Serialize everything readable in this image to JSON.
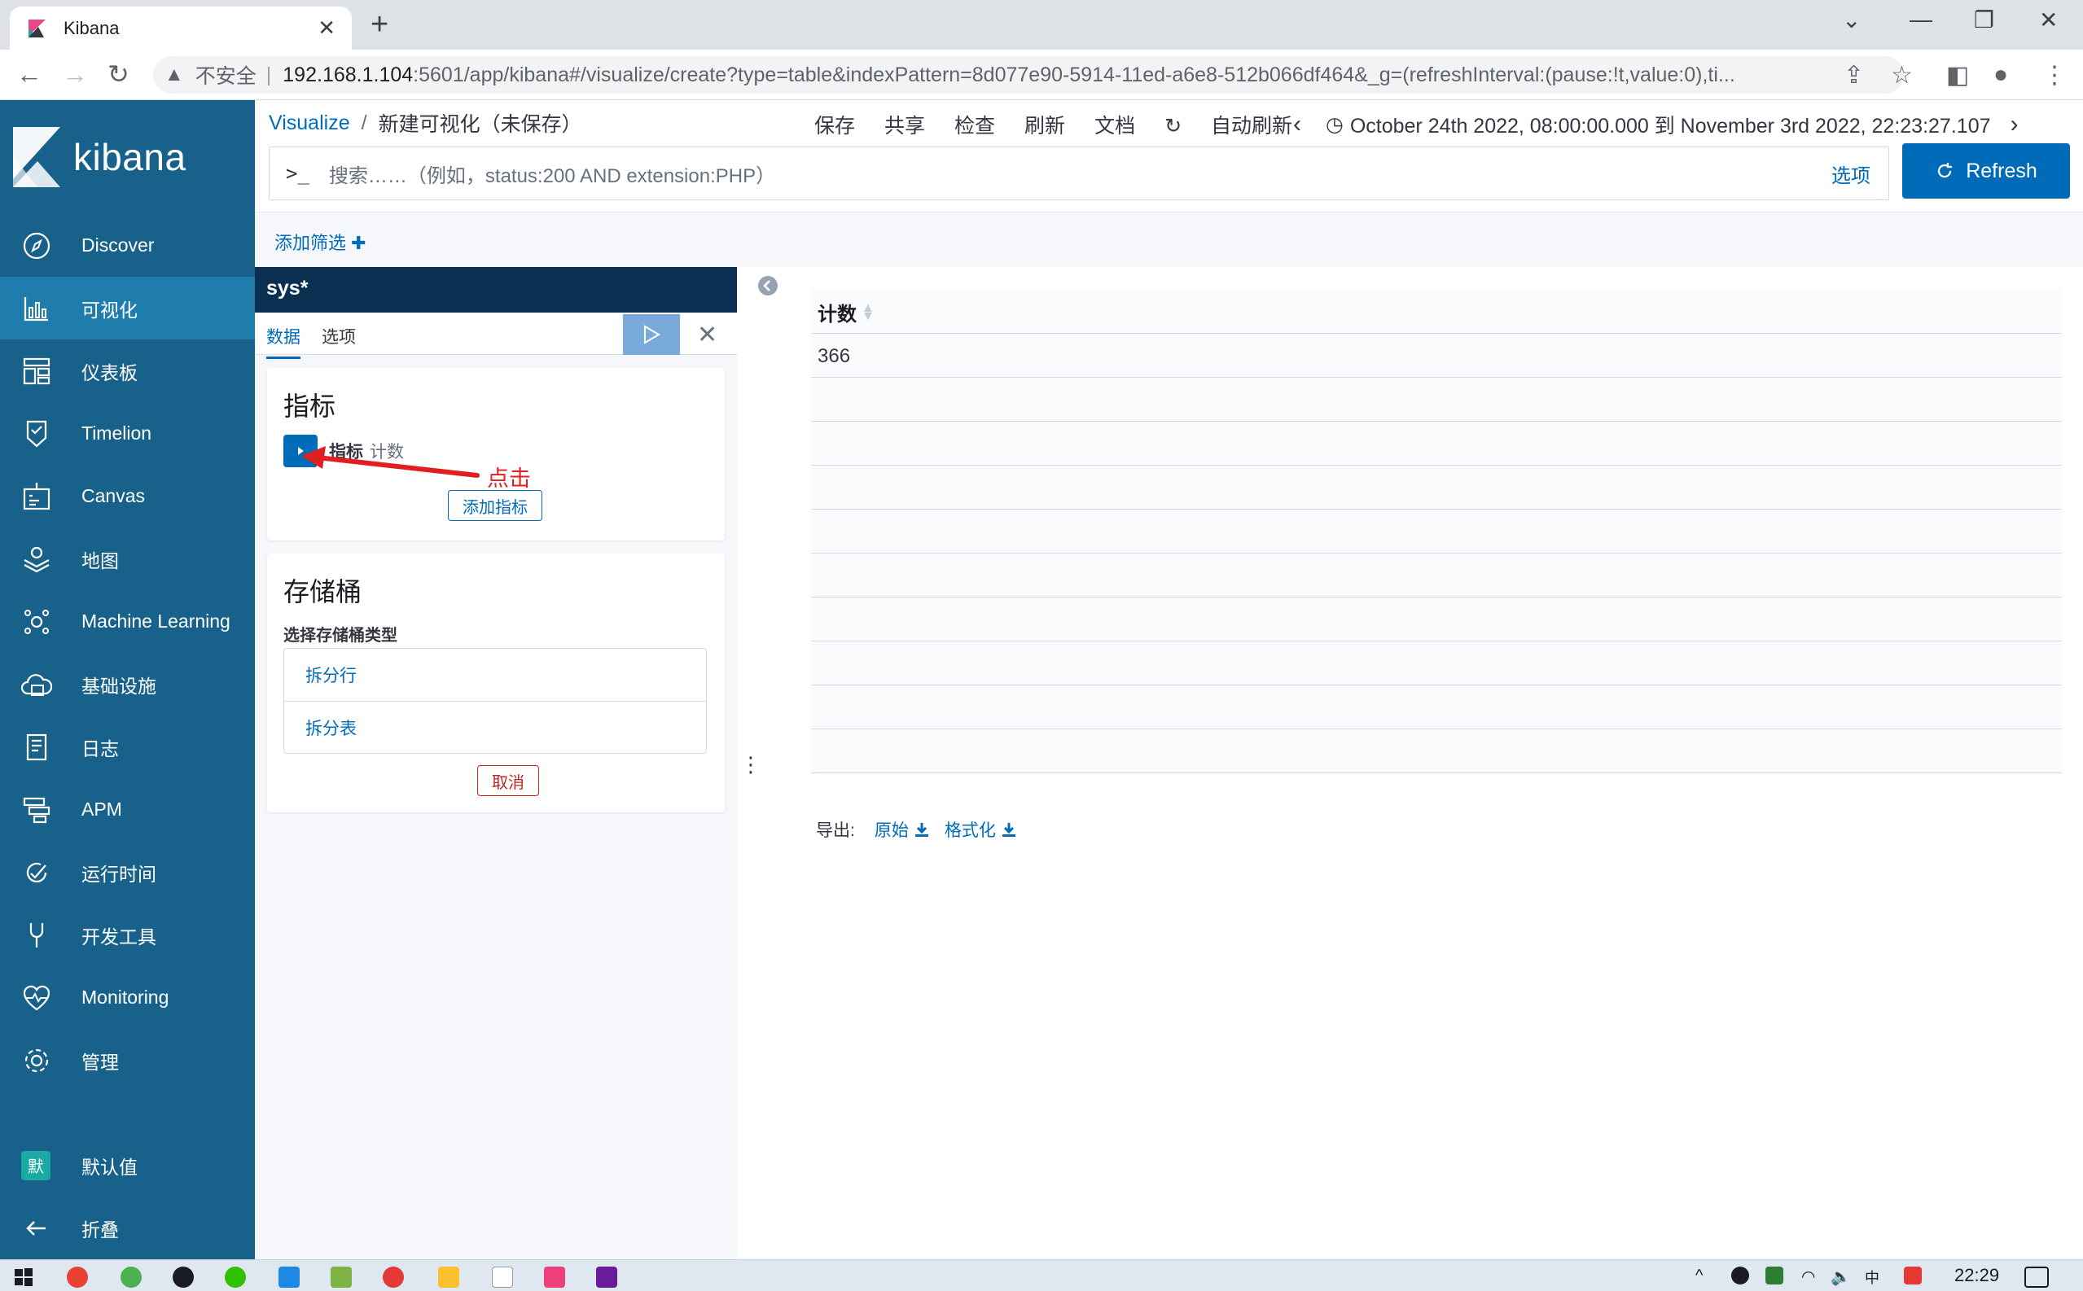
{
  "browser": {
    "tab_title": "Kibana",
    "tab_close": "✕",
    "new_tab": "+",
    "insecure_label": "不安全",
    "url_host": "192.168.1.104",
    "url_rest": ":5601/app/kibana#/visualize/create?type=table&indexPattern=8d077e90-5914-11ed-a6e8-512b066df464&_g=(refreshInterval:(pause:!t,value:0),ti..."
  },
  "sidebar": {
    "brand": "kibana",
    "items": [
      {
        "label": "Discover",
        "icon": "compass-icon"
      },
      {
        "label": "可视化",
        "icon": "visualize-icon"
      },
      {
        "label": "仪表板",
        "icon": "dashboard-icon"
      },
      {
        "label": "Timelion",
        "icon": "timelion-icon"
      },
      {
        "label": "Canvas",
        "icon": "canvas-icon"
      },
      {
        "label": "地图",
        "icon": "maps-icon"
      },
      {
        "label": "Machine Learning",
        "icon": "ml-icon"
      },
      {
        "label": "基础设施",
        "icon": "infrastructure-icon"
      },
      {
        "label": "日志",
        "icon": "logs-icon"
      },
      {
        "label": "APM",
        "icon": "apm-icon"
      },
      {
        "label": "运行时间",
        "icon": "uptime-icon"
      },
      {
        "label": "开发工具",
        "icon": "devtools-icon"
      },
      {
        "label": "Monitoring",
        "icon": "monitoring-icon"
      },
      {
        "label": "管理",
        "icon": "gear-icon"
      }
    ],
    "active_index": 1,
    "user_badge": "默",
    "user_label": "默认值",
    "collapse_label": "折叠"
  },
  "topbar": {
    "breadcrumb_root": "Visualize",
    "breadcrumb_sep": "/",
    "breadcrumb_current": "新建可视化（未保存）",
    "menu": [
      "保存",
      "共享",
      "检查",
      "刷新",
      "文档"
    ],
    "auto_refresh": "自动刷新",
    "time_range": "October 24th 2022, 08:00:00.000 到 November 3rd 2022, 22:23:27.107"
  },
  "query": {
    "prompt": ">_",
    "placeholder": "搜索……（例如，status:200 AND extension:PHP）",
    "options": "选项",
    "refresh": "Refresh"
  },
  "filter": {
    "add_label": "添加筛选"
  },
  "editor": {
    "index_pattern": "sys*",
    "tabs": [
      "数据",
      "选项"
    ],
    "metrics_title": "指标",
    "metric_label": "指标",
    "metric_value": "计数",
    "add_metric": "添加指标",
    "buckets_title": "存储桶",
    "bucket_type_label": "选择存储桶类型",
    "bucket_options": [
      "拆分行",
      "拆分表"
    ],
    "cancel": "取消"
  },
  "annotation": {
    "text": "点击",
    "color": "#e02020"
  },
  "table": {
    "column": "计数",
    "rows": [
      "366"
    ]
  },
  "export": {
    "label": "导出:",
    "raw": "原始",
    "formatted": "格式化"
  },
  "taskbar": {
    "clock": "22:29"
  },
  "colors": {
    "sidebar_bg": "#17618a",
    "sidebar_active": "#1f7dae",
    "primary": "#006bb8",
    "index_header": "#0a2f50",
    "danger": "#bd271e"
  }
}
